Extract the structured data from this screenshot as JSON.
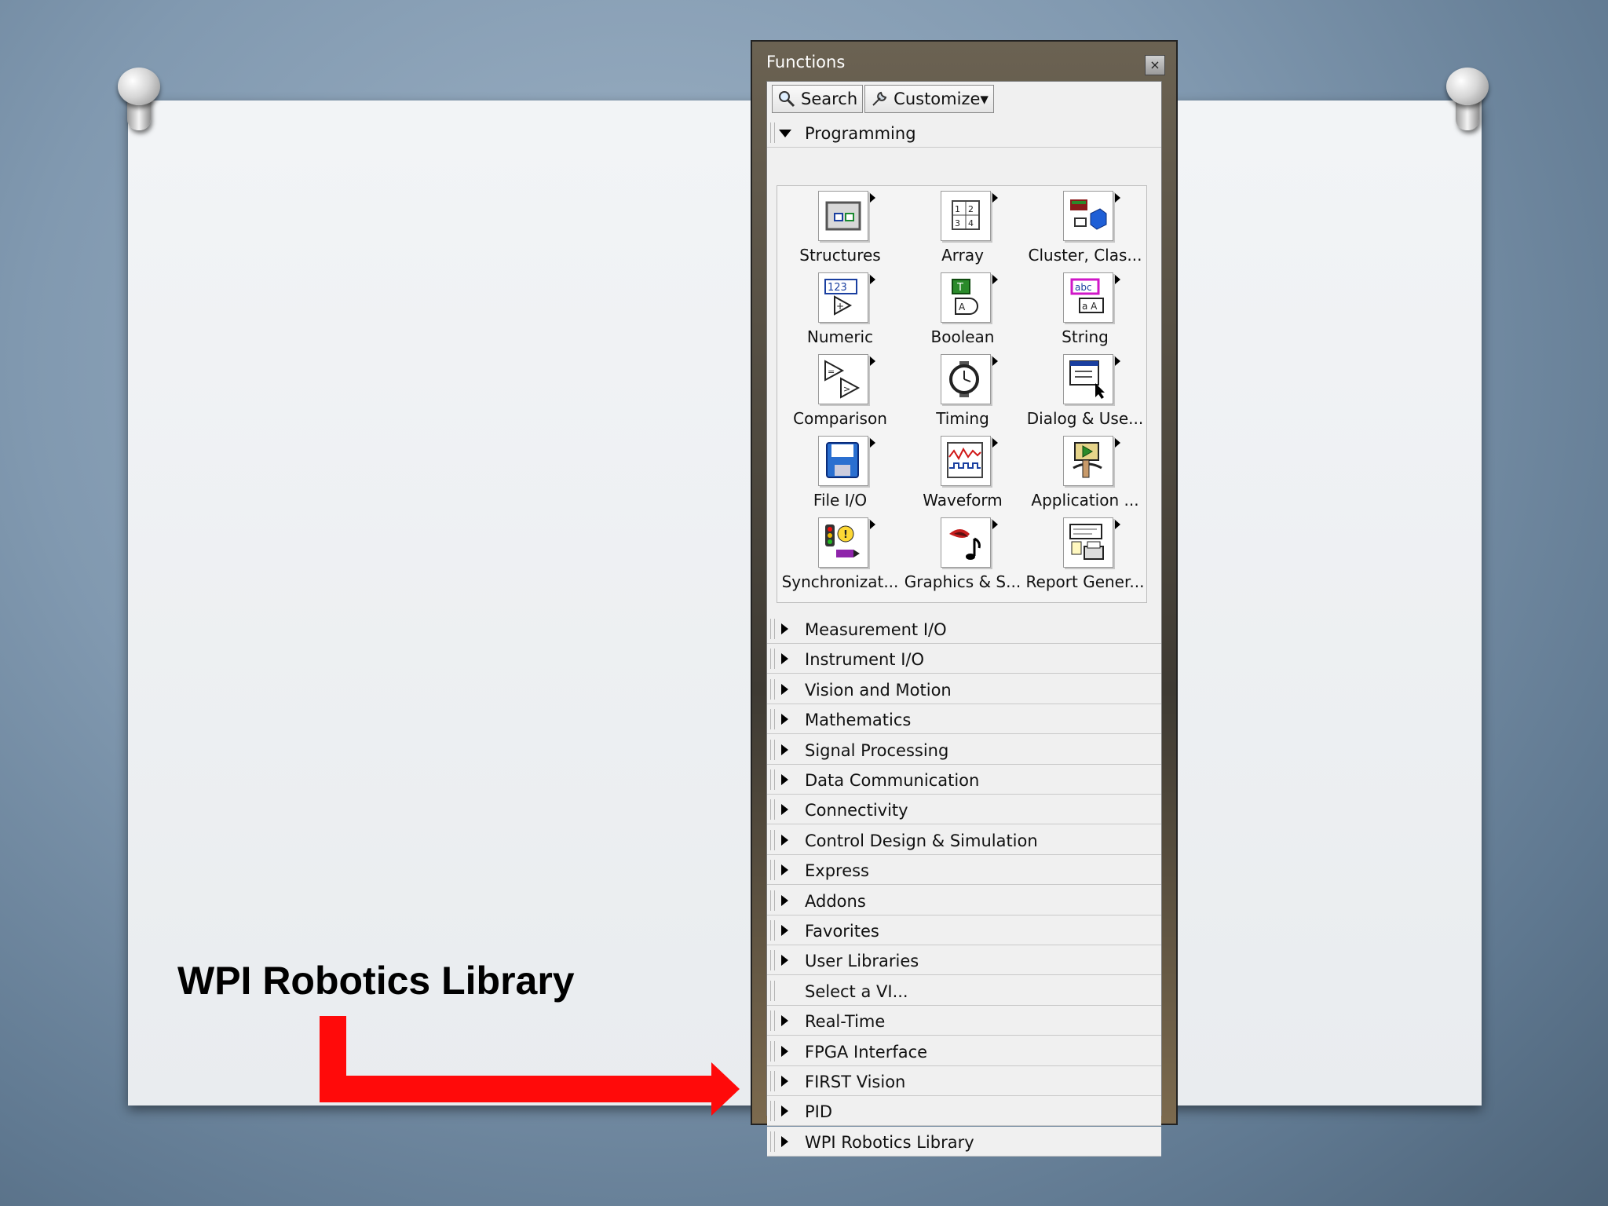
{
  "caption": "WPI Robotics Library",
  "window": {
    "title": "Functions",
    "close_glyph": "×",
    "toolbar": {
      "search_label": "Search",
      "customize_label": "Customize▾"
    }
  },
  "programming": {
    "label": "Programming",
    "items": [
      {
        "label": "Structures",
        "icon": "structures-icon"
      },
      {
        "label": "Array",
        "icon": "array-icon"
      },
      {
        "label": "Cluster, Clas...",
        "icon": "cluster-icon"
      },
      {
        "label": "Numeric",
        "icon": "numeric-icon"
      },
      {
        "label": "Boolean",
        "icon": "boolean-icon"
      },
      {
        "label": "String",
        "icon": "string-icon"
      },
      {
        "label": "Comparison",
        "icon": "comparison-icon"
      },
      {
        "label": "Timing",
        "icon": "timing-icon"
      },
      {
        "label": "Dialog & Use...",
        "icon": "dialog-icon"
      },
      {
        "label": "File I/O",
        "icon": "file-io-icon"
      },
      {
        "label": "Waveform",
        "icon": "waveform-icon"
      },
      {
        "label": "Application ...",
        "icon": "application-icon"
      },
      {
        "label": "Synchronizat...",
        "icon": "synchronization-icon"
      },
      {
        "label": "Graphics & S...",
        "icon": "graphics-icon"
      },
      {
        "label": "Report Gener...",
        "icon": "report-icon"
      }
    ]
  },
  "categories": [
    "Measurement I/O",
    "Instrument I/O",
    "Vision and Motion",
    "Mathematics",
    "Signal Processing",
    "Data Communication",
    "Connectivity",
    "Control Design & Simulation",
    "Express",
    "Addons",
    "Favorites",
    "User Libraries",
    "Select a VI...",
    "Real-Time",
    "FPGA Interface",
    "FIRST Vision",
    "PID",
    "WPI Robotics Library"
  ],
  "colors": {
    "arrow": "#ff0a0a"
  }
}
